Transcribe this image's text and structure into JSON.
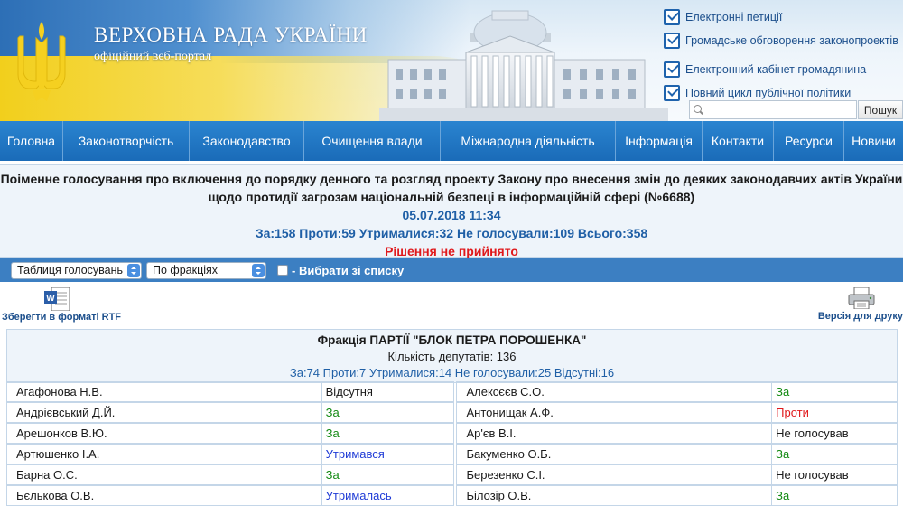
{
  "header": {
    "title": "ВЕРХОВНА РАДА УКРАЇНИ",
    "subtitle": "офіційний веб-портал",
    "quick_links": [
      "Електронні петиції",
      "Громадське обговорення законопроектів",
      "Електронний кабінет громадянина",
      "Повний цикл публічної політики"
    ],
    "search": {
      "placeholder": "",
      "button": "Пошук"
    }
  },
  "nav": [
    "Головна",
    "Законотворчість",
    "Законодавство",
    "Очищення влади",
    "Міжнародна діяльність",
    "Інформація",
    "Контакти",
    "Ресурси",
    "Новини"
  ],
  "vote": {
    "title_line1": "Поіменне голосування про включення до порядку денного та розгляд проекту Закону про внесення змін до деяких законодавчих актів України",
    "title_line2": "щодо протидії загрозам національній безпеці в інформаційній сфері (№6688)",
    "datetime": "05.07.2018 11:34",
    "totals": "За:158 Проти:59 Утрималися:32 Не голосували:109 Всього:358",
    "result": "Рішення не прийнято"
  },
  "toolbar": {
    "select1": "Таблиця голосувань",
    "select2": "По фракціях",
    "checkbox_label": "- Вибрати зі списку"
  },
  "export": {
    "rtf_label": "Зберегти в форматі RTF",
    "print_label": "Версія для друку"
  },
  "faction": {
    "name": "Фракція ПАРТІЇ \"БЛОК ПЕТРА ПОРОШЕНКА\"",
    "count": "Кількість депутатів: 136",
    "stats": "За:74 Проти:7 Утрималися:14 Не голосували:25 Відсутні:16"
  },
  "deputies": [
    {
      "left_name": "Агафонова Н.В.",
      "left_vote": "Відсутня",
      "left_kind": "none",
      "right_name": "Алексєєв С.О.",
      "right_vote": "За",
      "right_kind": "za"
    },
    {
      "left_name": "Андрієвський Д.Й.",
      "left_vote": "За",
      "left_kind": "za",
      "right_name": "Антонищак А.Ф.",
      "right_vote": "Проти",
      "right_kind": "proty"
    },
    {
      "left_name": "Арешонков В.Ю.",
      "left_vote": "За",
      "left_kind": "za",
      "right_name": "Ар'єв В.І.",
      "right_vote": "Не голосував",
      "right_kind": "none"
    },
    {
      "left_name": "Артюшенко І.А.",
      "left_vote": "Утримався",
      "left_kind": "utr",
      "right_name": "Бакуменко О.Б.",
      "right_vote": "За",
      "right_kind": "za"
    },
    {
      "left_name": "Барна О.С.",
      "left_vote": "За",
      "left_kind": "za",
      "right_name": "Березенко С.І.",
      "right_vote": "Не голосував",
      "right_kind": "none"
    },
    {
      "left_name": "Бєлькова О.В.",
      "left_vote": "Утрималась",
      "left_kind": "utr",
      "right_name": "Білозір О.В.",
      "right_vote": "За",
      "right_kind": "za"
    }
  ]
}
